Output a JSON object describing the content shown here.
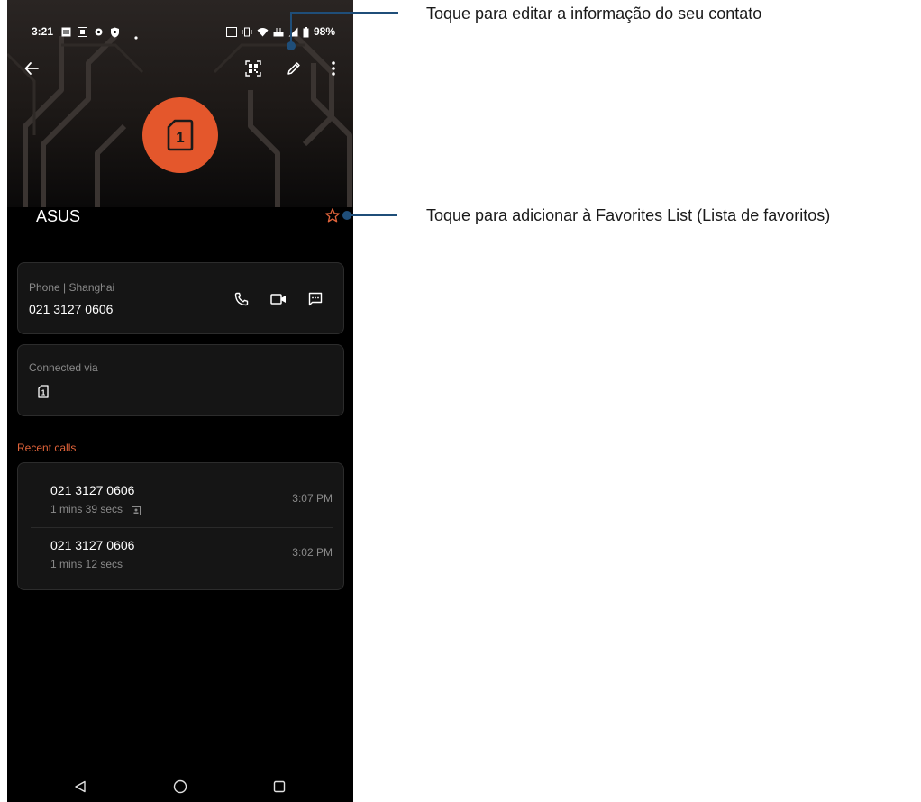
{
  "status_bar": {
    "time": "3:21",
    "battery": "98%"
  },
  "contact": {
    "name": "ASUS",
    "avatar_icon": "sim-card-icon",
    "avatar_badge": "1",
    "avatar_color": "#e4572c"
  },
  "phone_card": {
    "label": "Phone | Shanghai",
    "number": "021 3127 0606"
  },
  "connected_card": {
    "label": "Connected via",
    "sim_badge": "1"
  },
  "recent_calls": {
    "title": "Recent calls",
    "calls": [
      {
        "number": "021 3127 0606",
        "duration": "1 mins 39 secs",
        "time": "3:07 PM"
      },
      {
        "number": "021 3127 0606",
        "duration": "1 mins 12 secs",
        "time": "3:02 PM"
      }
    ]
  },
  "annotations": {
    "edit": "Toque para editar a informação do seu contato",
    "favorite": "Toque para adicionar à Favorites List (Lista de favoritos)"
  },
  "colors": {
    "accent": "#e0633a",
    "callout": "#1f4e79",
    "background": "#000000"
  }
}
